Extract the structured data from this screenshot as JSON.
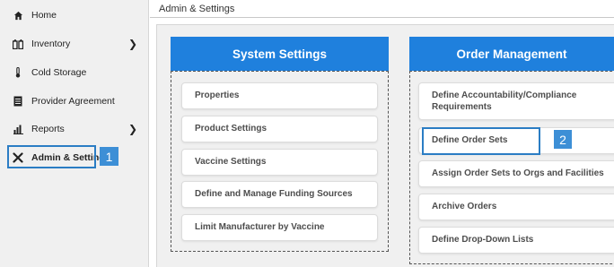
{
  "sidebar": {
    "items": [
      {
        "label": "Home",
        "icon": "home-icon",
        "has_arrow": false
      },
      {
        "label": "Inventory",
        "icon": "inventory-icon",
        "has_arrow": true
      },
      {
        "label": "Cold Storage",
        "icon": "thermometer-icon",
        "has_arrow": false
      },
      {
        "label": "Provider Agreement",
        "icon": "document-icon",
        "has_arrow": false
      },
      {
        "label": "Reports",
        "icon": "bar-chart-icon",
        "has_arrow": true
      },
      {
        "label": "Admin & Settings",
        "icon": "tools-icon",
        "has_arrow": false,
        "active": true
      }
    ]
  },
  "main": {
    "title": "Admin & Settings"
  },
  "system_settings": {
    "header": "System Settings",
    "items": [
      "Properties",
      "Product Settings",
      "Vaccine Settings",
      "Define and Manage Funding Sources",
      "Limit Manufacturer by Vaccine"
    ]
  },
  "order_management": {
    "header": "Order Management",
    "items": [
      "Define Accountability/Compliance Requirements",
      "Define Order Sets",
      "Assign Order Sets to Orgs and Facilities",
      "Archive Orders",
      "Define Drop-Down Lists"
    ]
  },
  "callouts": [
    "1",
    "2"
  ],
  "colors": {
    "header_blue": "#1f80dd",
    "callout_blue": "#2b7dc4",
    "sidebar_bg": "#f0f0f0"
  }
}
